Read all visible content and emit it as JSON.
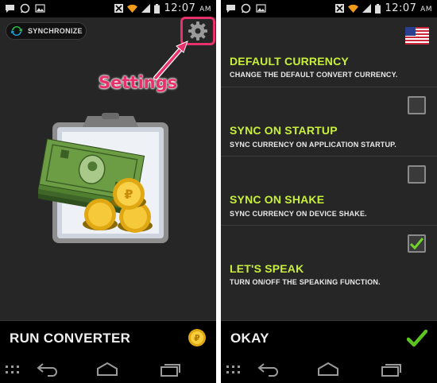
{
  "left": {
    "status": {
      "time": "12:07",
      "ampm": "AM"
    },
    "sync_label": "SYNCHRONIZE",
    "annotation": "Settings",
    "bottom": {
      "label": "RUN CONVERTER"
    }
  },
  "right": {
    "status": {
      "time": "12:07",
      "ampm": "AM"
    },
    "settings": [
      {
        "title": "DEFAULT CURRENCY",
        "description": "CHANGE THE DEFAULT CONVERT CURRENCY."
      },
      {
        "title": "SYNC ON STARTUP",
        "description": "SYNC CURRENCY ON APPLICATION STARTUP.",
        "checked": false
      },
      {
        "title": "SYNC ON SHAKE",
        "description": "SYNC CURRENCY ON DEVICE SHAKE.",
        "checked": false
      },
      {
        "title": "LET'S SPEAK",
        "description": "TURN ON/OFF THE SPEAKING FUNCTION.",
        "checked": true
      }
    ],
    "bottom": {
      "label": "OKAY"
    }
  },
  "colors": {
    "accent_green": "#c8ef3c",
    "annotation_pink": "#e8306a",
    "background": "#262626"
  }
}
